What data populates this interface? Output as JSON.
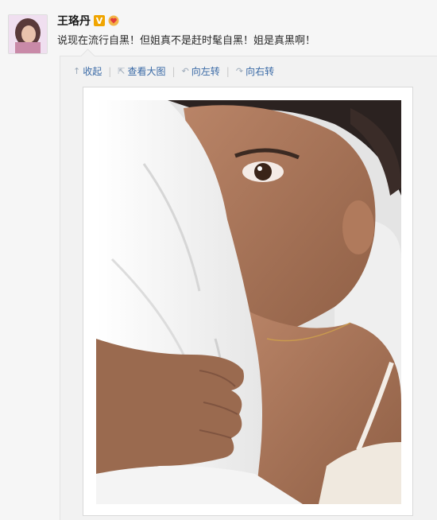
{
  "post": {
    "author": {
      "name": "王珞丹",
      "verified_badge": "V",
      "fans_icon": "heart-fans-icon"
    },
    "text": "说现在流行自黑！但姐真不是赶时髦自黑！姐是真黑啊！",
    "toolbar": {
      "collapse": {
        "icon": "↑",
        "label": "收起"
      },
      "view_large": {
        "icon": "⇱",
        "label": "查看大图"
      },
      "rotate_left": {
        "icon": "↶",
        "label": "向左转"
      },
      "rotate_right": {
        "icon": "↷",
        "label": "向右转"
      }
    },
    "colors": {
      "link": "#3a6aa6",
      "badge": "#f0a500",
      "background": "#f6f6f6"
    }
  }
}
